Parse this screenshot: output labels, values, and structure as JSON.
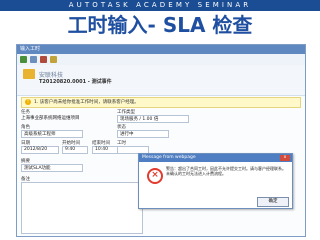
{
  "banner": "AUTOTASK ACADEMY SEMINAR",
  "slide_title": "工时输入- SLA 检查",
  "window": {
    "title": "输入工时",
    "header": {
      "entity": "安联科技",
      "record": "T20120820.0001 - 测试事件"
    },
    "warning": "1. 该客户尚未给你批准工作时间，请联系客户经理。",
    "form": {
      "left_labels": [
        "任务",
        "角色",
        "日期",
        "开始时间",
        "结束时间",
        "备注"
      ],
      "task_value": "上海事业部系统网络运维项目",
      "role_value": "高级系统工程师",
      "date_value": "2012/8/20",
      "start_value": "9:40",
      "end_value": "10:40",
      "worktype_label": "工作类型",
      "worktype_value": "现场服务 / 1.00 倍",
      "status_label": "状态",
      "status_value": "进行中",
      "hours_label": "工时",
      "note_label": "摘要",
      "note_value": "测试SLA功能"
    }
  },
  "dialog": {
    "title": "Message from webpage",
    "close": "x",
    "icon": "error-icon",
    "message": "警告：超出了合同工时，因此不允许提交工时。请与客户经理联系。未确认的工时无法进入计费流程。",
    "ok": "确定"
  }
}
